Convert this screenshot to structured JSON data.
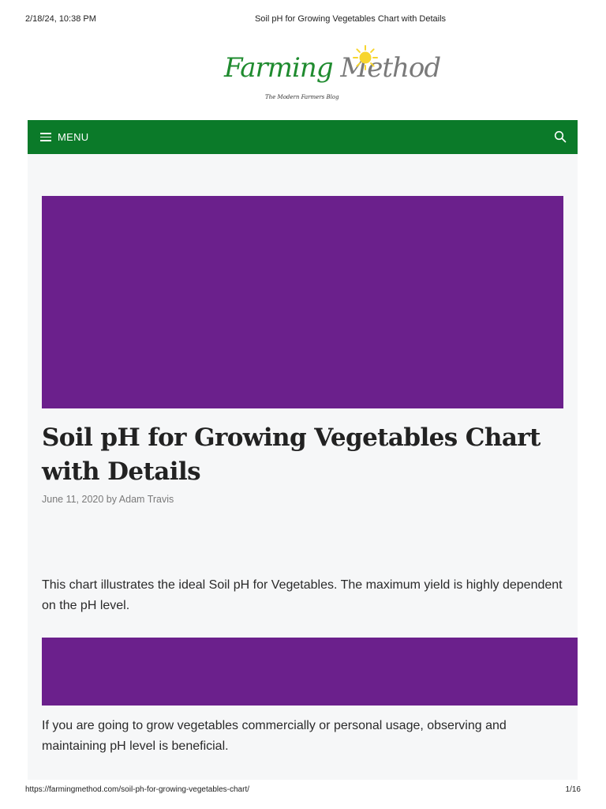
{
  "print": {
    "date": "2/18/24, 10:38 PM",
    "title": "Soil pH for Growing Vegetables Chart with Details",
    "url": "https://farmingmethod.com/soil-ph-for-growing-vegetables-chart/",
    "page": "1/16"
  },
  "logo": {
    "word1": "Farming",
    "word2": "Method",
    "tagline": "The Modern Farmers Blog",
    "colors": {
      "primary": "#1f8b2f",
      "secondary": "#7a7a7a",
      "sun": "#f7d52e"
    }
  },
  "nav": {
    "menu_label": "MENU",
    "menu_icon": "hamburger-icon",
    "search_icon": "search-icon",
    "background": "#0b7a29"
  },
  "article": {
    "title": "Soil pH for Growing Vegetables Chart with Details",
    "date": "June 11, 2020",
    "by": "by",
    "author": "Adam Travis",
    "intro": "This chart illustrates the ideal Soil pH for Vegetables. The maximum yield is highly dependent on the pH level.",
    "paragraph2": "If you are going to grow vegetables commercially or personal usage, observing and maintaining pH level is beneficial.",
    "banner_color": "#6b208c"
  }
}
